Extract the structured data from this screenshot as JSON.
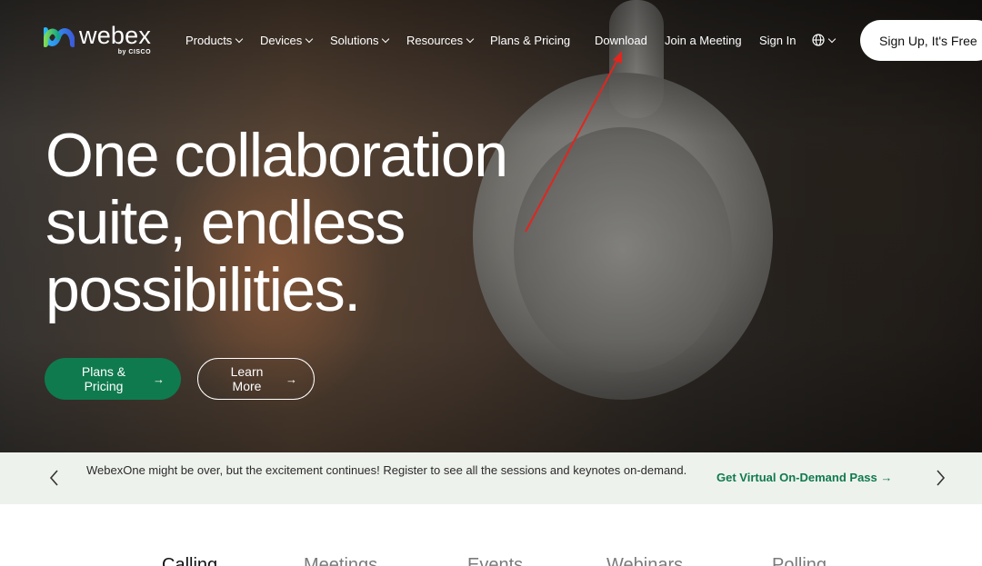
{
  "nav": {
    "logo": {
      "word": "webex",
      "sub": "by CISCO"
    },
    "items": [
      {
        "label": "Products",
        "dropdown": true
      },
      {
        "label": "Devices",
        "dropdown": true
      },
      {
        "label": "Solutions",
        "dropdown": true
      },
      {
        "label": "Resources",
        "dropdown": true
      },
      {
        "label": "Plans & Pricing",
        "dropdown": false
      },
      {
        "label": "Download",
        "dropdown": false
      },
      {
        "label": "Join a Meeting",
        "dropdown": false
      },
      {
        "label": "Sign In",
        "dropdown": false
      }
    ],
    "language_icon": "globe-icon",
    "signup_label": "Sign Up, It's Free"
  },
  "hero": {
    "title_lines": [
      "One collaboration",
      "suite, endless",
      "possibilities."
    ],
    "primary_cta": "Plans & Pricing",
    "secondary_cta": "Learn More",
    "arrow_glyph": "→"
  },
  "banner": {
    "text": "WebexOne might be over, but the excitement continues! Register to see all the sessions and keynotes on-demand.",
    "link": "Get Virtual On-Demand Pass",
    "link_arrow": "→"
  },
  "tabs": [
    "Calling",
    "Meetings",
    "Events",
    "Webinars",
    "Polling"
  ],
  "colors": {
    "accent_green": "#0f7a4e",
    "banner_bg": "#eef2ec",
    "annotation_red": "#e0261f"
  }
}
